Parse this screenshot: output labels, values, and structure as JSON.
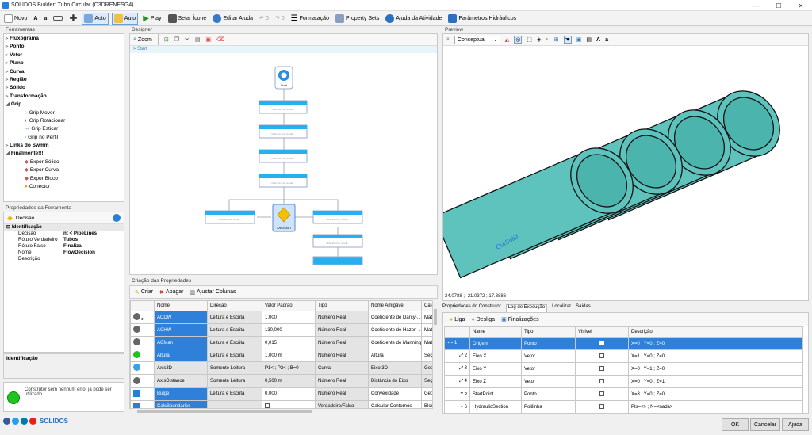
{
  "window": {
    "title": "SOLIDOS Builder: Tubo Circular (C3DRENESG4)"
  },
  "toolbar": {
    "novo": "Novo",
    "a1": "A",
    "a2": "a",
    "auto1": "Auto",
    "auto2": "Auto",
    "play": "Play",
    "setar_icone": "Setar Ícone",
    "editar_ajuda": "Editar Ajuda",
    "undo_count": "0",
    "redo_count": "0",
    "formatacao": "Formatação",
    "property_sets": "Property Sets",
    "ajuda_atividade": "Ajuda da Atividade",
    "parametros": "Parâmetros Hidráulicos"
  },
  "ferramentas": {
    "title": "Ferramentas",
    "items": [
      "Fluxograma",
      "Ponto",
      "Vetor",
      "Plano",
      "Curva",
      "Região",
      "Sólido",
      "Transformação",
      "Grip"
    ],
    "grip_children": [
      "Grip Mover",
      "Grip Rotacionar",
      "Grip Esticar",
      "Grip no Perfil"
    ],
    "links": "Links do Swmm",
    "finalmente": "Finalmente!!!",
    "final_children": [
      "Expor Sólido",
      "Expor Curva",
      "Expor Bloco",
      "Conector"
    ]
  },
  "propriedades": {
    "title": "Propriedades da Ferramenta",
    "tool": "Decisão",
    "section": "Identificação",
    "rows": [
      {
        "k": "Decisão",
        "v": "nt < PipeLines"
      },
      {
        "k": "Rótulo Verdadeiro",
        "v": "Tubos"
      },
      {
        "k": "Rótulo Falso",
        "v": "Finaliza"
      },
      {
        "k": "Nome",
        "v": "FlowDecision"
      },
      {
        "k": "Descrição",
        "v": ""
      }
    ],
    "footer": "Identificação"
  },
  "status": {
    "msg": "Construtor sem nenhum erro, já pode ser utilizado"
  },
  "designer": {
    "title": "Designer",
    "zoom": "Zoom",
    "breadcrumb": "> Start",
    "start": "Start",
    "decision": "Decision",
    "node_hint": "Click the icon to edit..."
  },
  "criacao": {
    "title": "Criação das Propriedades",
    "criar": "Criar",
    "apagar": "Apagar",
    "ajustar": "Ajustar Colunas",
    "headers": [
      "Nome",
      "Direção",
      "Valor Padrão",
      "Tipo",
      "Nome Amigável",
      "Cate"
    ],
    "rows": [
      {
        "nome": "ACDW",
        "dir": "Leitura e Escrita",
        "val": "1,000",
        "tipo": "Número Real",
        "amig": "Coeficiente de Darcy-...",
        "cat": "Mate"
      },
      {
        "nome": "ACHW",
        "dir": "Leitura e Escrita",
        "val": "130,000",
        "tipo": "Número Real",
        "amig": "Coeficiente de Hazen-...",
        "cat": "Mate"
      },
      {
        "nome": "ACMan",
        "dir": "Leitura e Escrita",
        "val": "0,015",
        "tipo": "Número Real",
        "amig": "Coeficiente de Manning",
        "cat": "Mate"
      },
      {
        "nome": "Altura",
        "dir": "Leitura e Escrita",
        "val": "1,000 m",
        "tipo": "Número Real",
        "amig": "Altura",
        "cat": "Seçã"
      },
      {
        "nome": "Axis3D",
        "dir": "Somente Leitura",
        "val": "P1< ; P2< ; B=0",
        "tipo": "Curva",
        "amig": "Eixo 3D",
        "cat": "Geom"
      },
      {
        "nome": "AxisDistance",
        "dir": "Somente Leitura",
        "val": "0,500 m",
        "tipo": "Número Real",
        "amig": "Distância do Eixo",
        "cat": "Seçã"
      },
      {
        "nome": "Bulge",
        "dir": "Leitura e Escrita",
        "val": "0,000",
        "tipo": "Número Real",
        "amig": "Convexidade",
        "cat": "Geom"
      },
      {
        "nome": "CalcBoundaries",
        "dir": "Leitura e Escrita",
        "val": "",
        "tipo": "Verdadeiro/Falso",
        "amig": "Calcular Contornos",
        "cat": "Bloco"
      }
    ]
  },
  "preview": {
    "title": "Preview",
    "mode": "Conceptual",
    "a1": "A",
    "a2": "a",
    "label3d": "OutSolid",
    "coords": "24.0788 ; -21.0372 ; 17.3886"
  },
  "tabs": [
    "Propriedades do Construtor",
    "Log de Execução",
    "Localizar",
    "Saídas"
  ],
  "exec": {
    "liga": "Liga",
    "desliga": "Desliga",
    "finalizacoes": "Finalizações",
    "headers": [
      "",
      "Name",
      "Tipo",
      "Visível",
      "Descrição"
    ],
    "rows": [
      {
        "n": "1",
        "name": "Origem",
        "tipo": "Ponto",
        "desc": "X=0 ; Y=0 ; Z=0"
      },
      {
        "n": "2",
        "name": "Eixo X",
        "tipo": "Vetor",
        "desc": "X=1 ; Y=0 ; Z=0"
      },
      {
        "n": "3",
        "name": "Eixo Y",
        "tipo": "Vetor",
        "desc": "X=0 ; Y=1 ; Z=0"
      },
      {
        "n": "4",
        "name": "Eixo Z",
        "tipo": "Vetor",
        "desc": "X=0 ; Y=0 ; Z=1"
      },
      {
        "n": "5",
        "name": "StartPoint",
        "tipo": "Ponto",
        "desc": "X=3 ; Y=0 ; Z=0"
      },
      {
        "n": "6",
        "name": "HydraulicSection",
        "tipo": "Polilinha",
        "desc": "Pts=<> ; N=<nada>"
      }
    ]
  },
  "buttons": {
    "ok": "OK",
    "cancelar": "Cancelar",
    "ajuda": "Ajuda"
  },
  "colors": {
    "accent": "#2f80d8",
    "node": "#25b1f0",
    "pipe": "#5ec3bd",
    "ok": "#1fc41f"
  }
}
